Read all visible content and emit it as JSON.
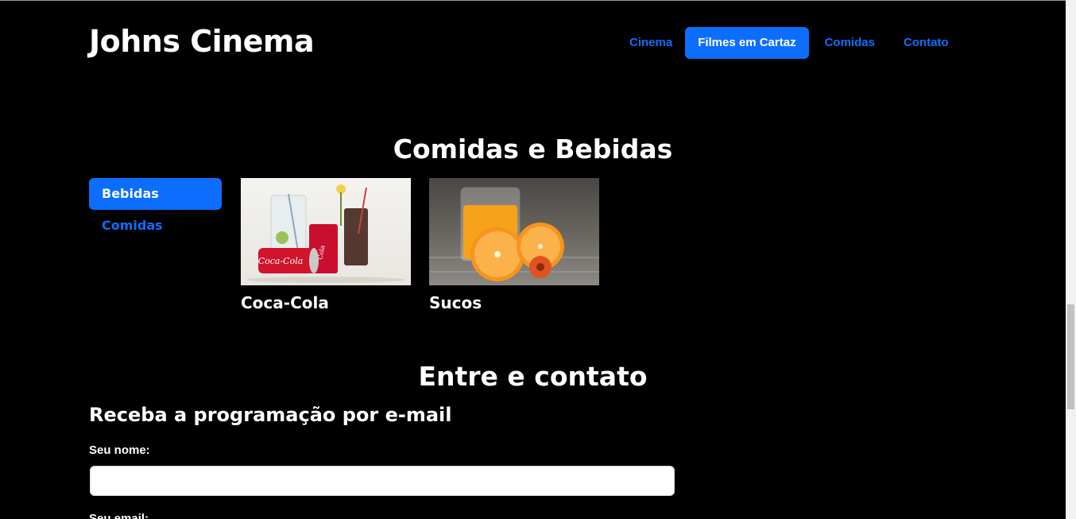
{
  "header": {
    "brand": "Johns Cinema",
    "nav": [
      {
        "label": "Cinema",
        "active": false
      },
      {
        "label": "Filmes em Cartaz",
        "active": true
      },
      {
        "label": "Comidas",
        "active": false
      },
      {
        "label": "Contato",
        "active": false
      }
    ]
  },
  "food_section": {
    "title": "Comidas e Bebidas",
    "pills": [
      {
        "label": "Bebidas",
        "active": true
      },
      {
        "label": "Comidas",
        "active": false
      }
    ],
    "cards": [
      {
        "name": "Coca-Cola",
        "image": "coca-cola-photo"
      },
      {
        "name": "Sucos",
        "image": "orange-juice-photo"
      }
    ]
  },
  "contact_section": {
    "title": "Entre e contato",
    "form_title": "Receba a programação por e-mail",
    "name_label": "Seu nome:",
    "name_value": "",
    "email_label": "Seu email:"
  },
  "colors": {
    "background": "#000000",
    "accent": "#0d6efd"
  }
}
